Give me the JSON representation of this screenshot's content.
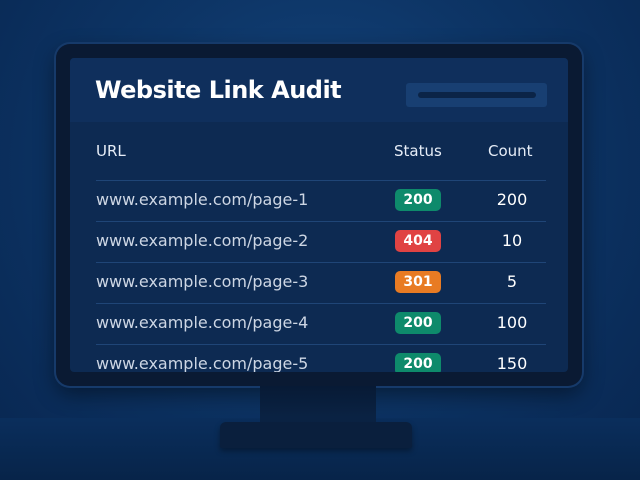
{
  "app": {
    "title": "Website Link Audit"
  },
  "search": {
    "value": ""
  },
  "table": {
    "headers": {
      "url": "URL",
      "status": "Status",
      "count": "Count"
    },
    "rows": [
      {
        "url": "www.example.com/page-1",
        "status": "200",
        "status_kind": "ok",
        "count": "200"
      },
      {
        "url": "www.example.com/page-2",
        "status": "404",
        "status_kind": "err",
        "count": "10"
      },
      {
        "url": "www.example.com/page-3",
        "status": "301",
        "status_kind": "redir",
        "count": "5"
      },
      {
        "url": "www.example.com/page-4",
        "status": "200",
        "status_kind": "ok",
        "count": "100"
      },
      {
        "url": "www.example.com/page-5",
        "status": "200",
        "status_kind": "ok",
        "count": "150"
      }
    ]
  },
  "colors": {
    "status_ok": "#0e8a6b",
    "status_error": "#e04343",
    "status_redirect": "#e87b23",
    "background": "#0d3566",
    "screen": "#0d2a52"
  }
}
